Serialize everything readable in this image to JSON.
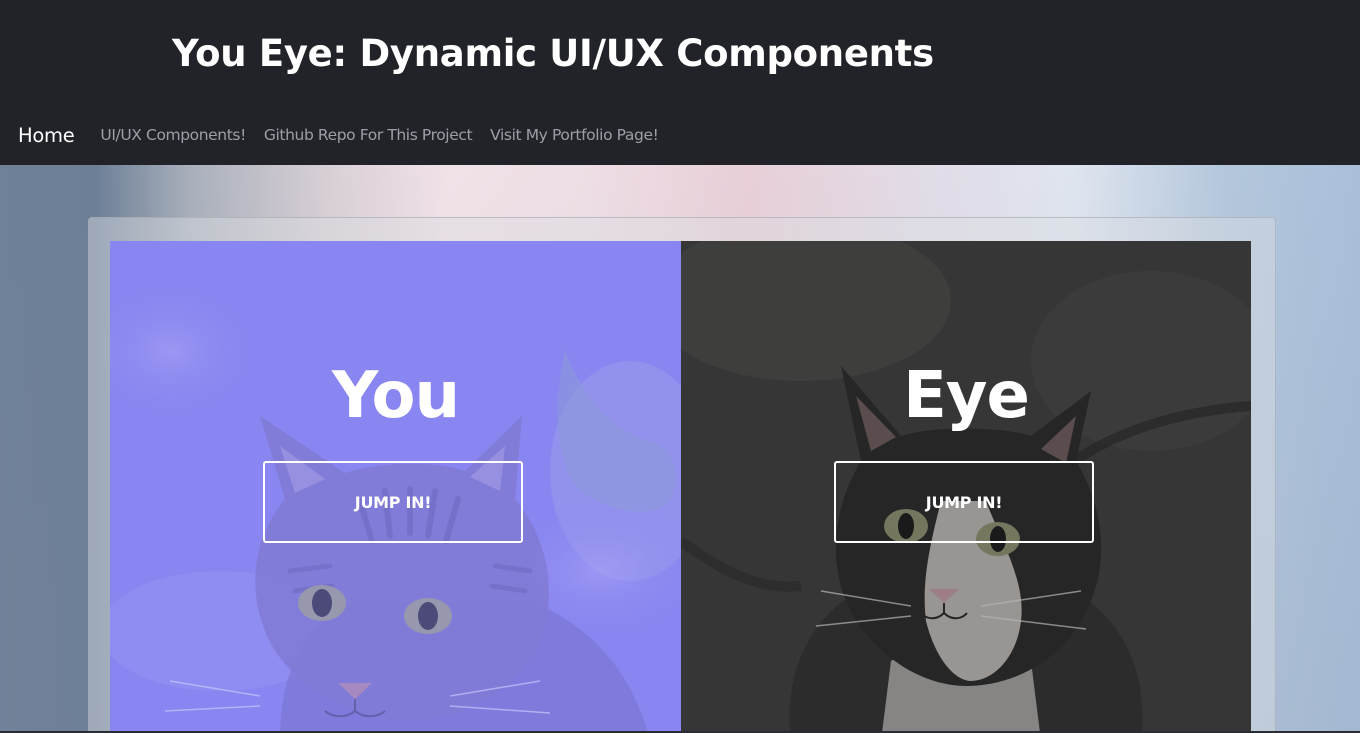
{
  "header": {
    "title": "You Eye: Dynamic UI/UX Components"
  },
  "nav": {
    "home": "Home",
    "components": "UI/UX Components!",
    "github": "Github Repo For This Project",
    "portfolio": "Visit My Portfolio Page!"
  },
  "panels": {
    "you": {
      "heading": "You",
      "button_label": "JUMP IN!",
      "overlay_color": "#8a86f1"
    },
    "eye": {
      "heading": "Eye",
      "button_label": "JUMP IN!",
      "overlay_color": "#3b3a3a"
    }
  },
  "colors": {
    "header_bg": "#212329",
    "nav_inactive": "#9aa0a6",
    "nav_active": "#ffffff"
  },
  "icons": {
    "you_background": "tabby-cat-photo",
    "eye_background": "tuxedo-cat-photo"
  }
}
